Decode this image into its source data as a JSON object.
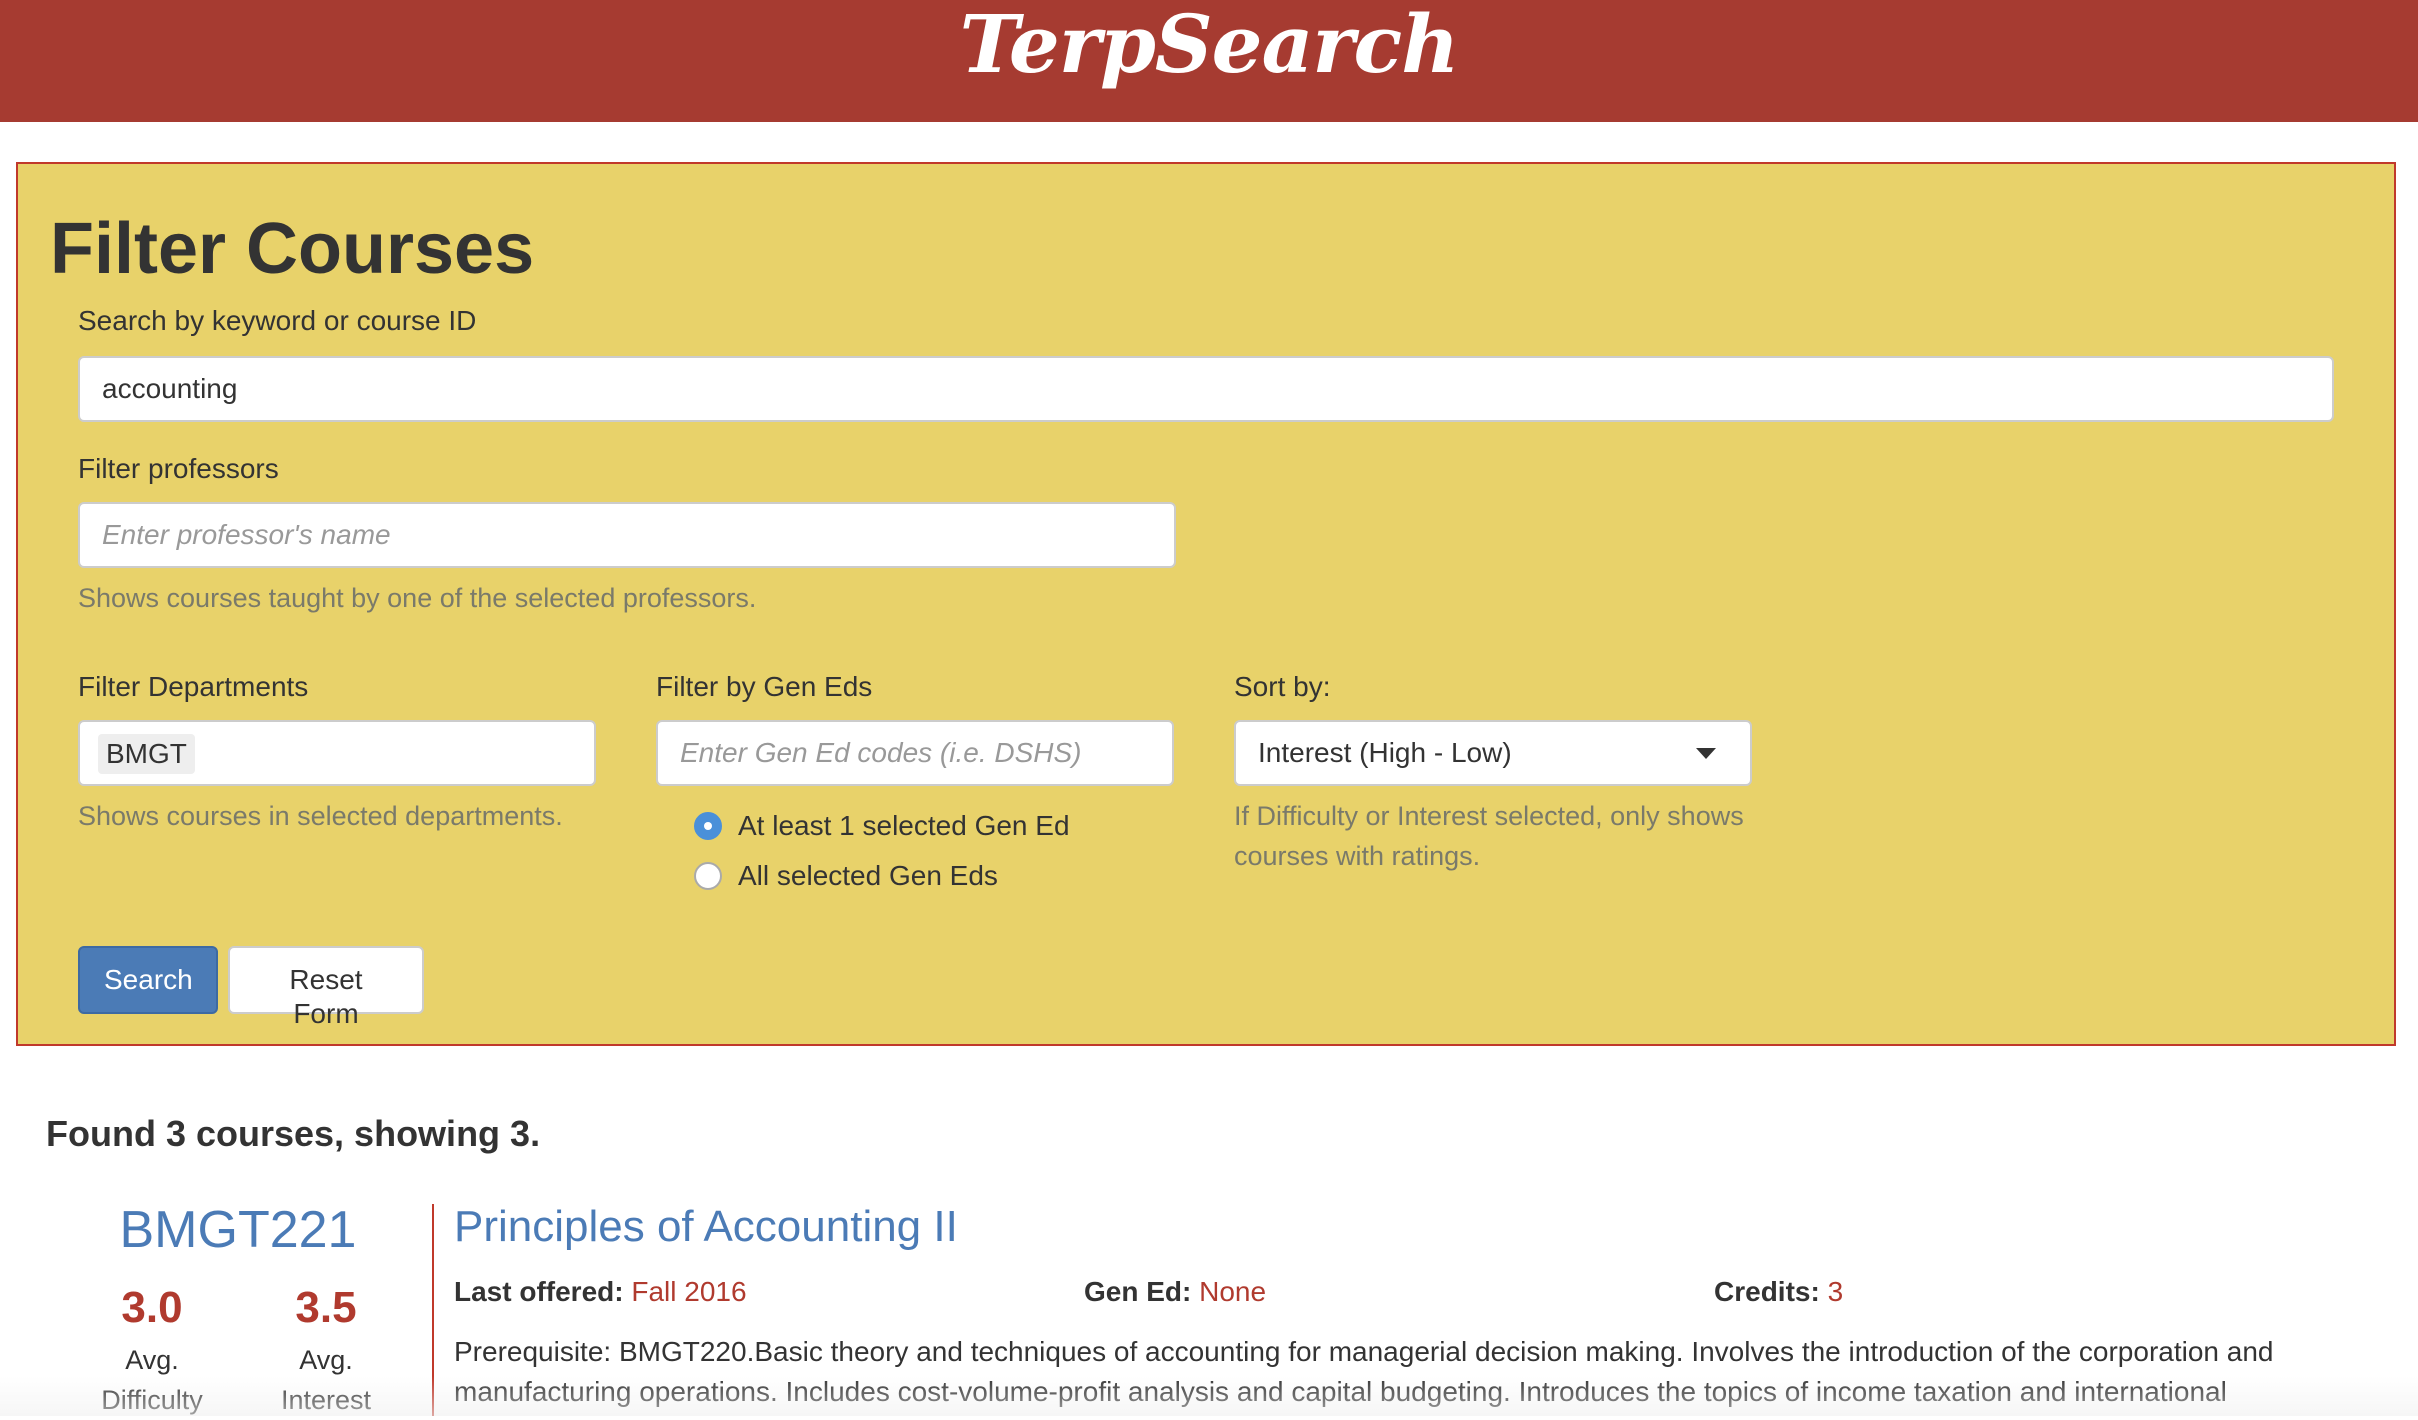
{
  "header": {
    "brand": "TerpSearch"
  },
  "filter": {
    "title": "Filter Courses",
    "keyword_label": "Search by keyword or course ID",
    "keyword_value": "accounting",
    "professors_label": "Filter professors",
    "professors_placeholder": "Enter professor's name",
    "professors_help": "Shows courses taught by one of the selected professors.",
    "departments_label": "Filter Departments",
    "departments_tag": "BMGT",
    "departments_help": "Shows courses in selected departments.",
    "geneds_label": "Filter by Gen Eds",
    "geneds_placeholder": "Enter Gen Ed codes (i.e. DSHS)",
    "geneds_option_any": "At least 1 selected Gen Ed",
    "geneds_option_all": "All selected Gen Eds",
    "sort_label": "Sort by:",
    "sort_value": "Interest (High - Low)",
    "sort_help": "If Difficulty or Interest selected, only shows courses with ratings.",
    "search_button": "Search",
    "reset_button": "Reset Form"
  },
  "results": {
    "summary": "Found 3 courses, showing 3.",
    "courses": [
      {
        "id": "BMGT221",
        "difficulty": "3.0",
        "difficulty_label": "Avg. Difficulty",
        "interest": "3.5",
        "interest_label": "Avg. Interest",
        "title": "Principles of Accounting II",
        "last_offered_label": "Last offered:",
        "last_offered": "Fall 2016",
        "gen_ed_label": "Gen Ed:",
        "gen_ed": "None",
        "credits_label": "Credits:",
        "credits": "3",
        "description": "Prerequisite: BMGT220.Basic theory and techniques of accounting for managerial decision making. Involves the introduction of the corporation and manufacturing operations. Includes cost-volume-profit analysis and capital budgeting. Introduces the topics of income taxation and international"
      }
    ]
  },
  "colors": {
    "header_bg": "#a63b31",
    "panel_bg": "#e8d26a",
    "link_blue": "#4b7bb6",
    "accent_red": "#b03a2e"
  }
}
